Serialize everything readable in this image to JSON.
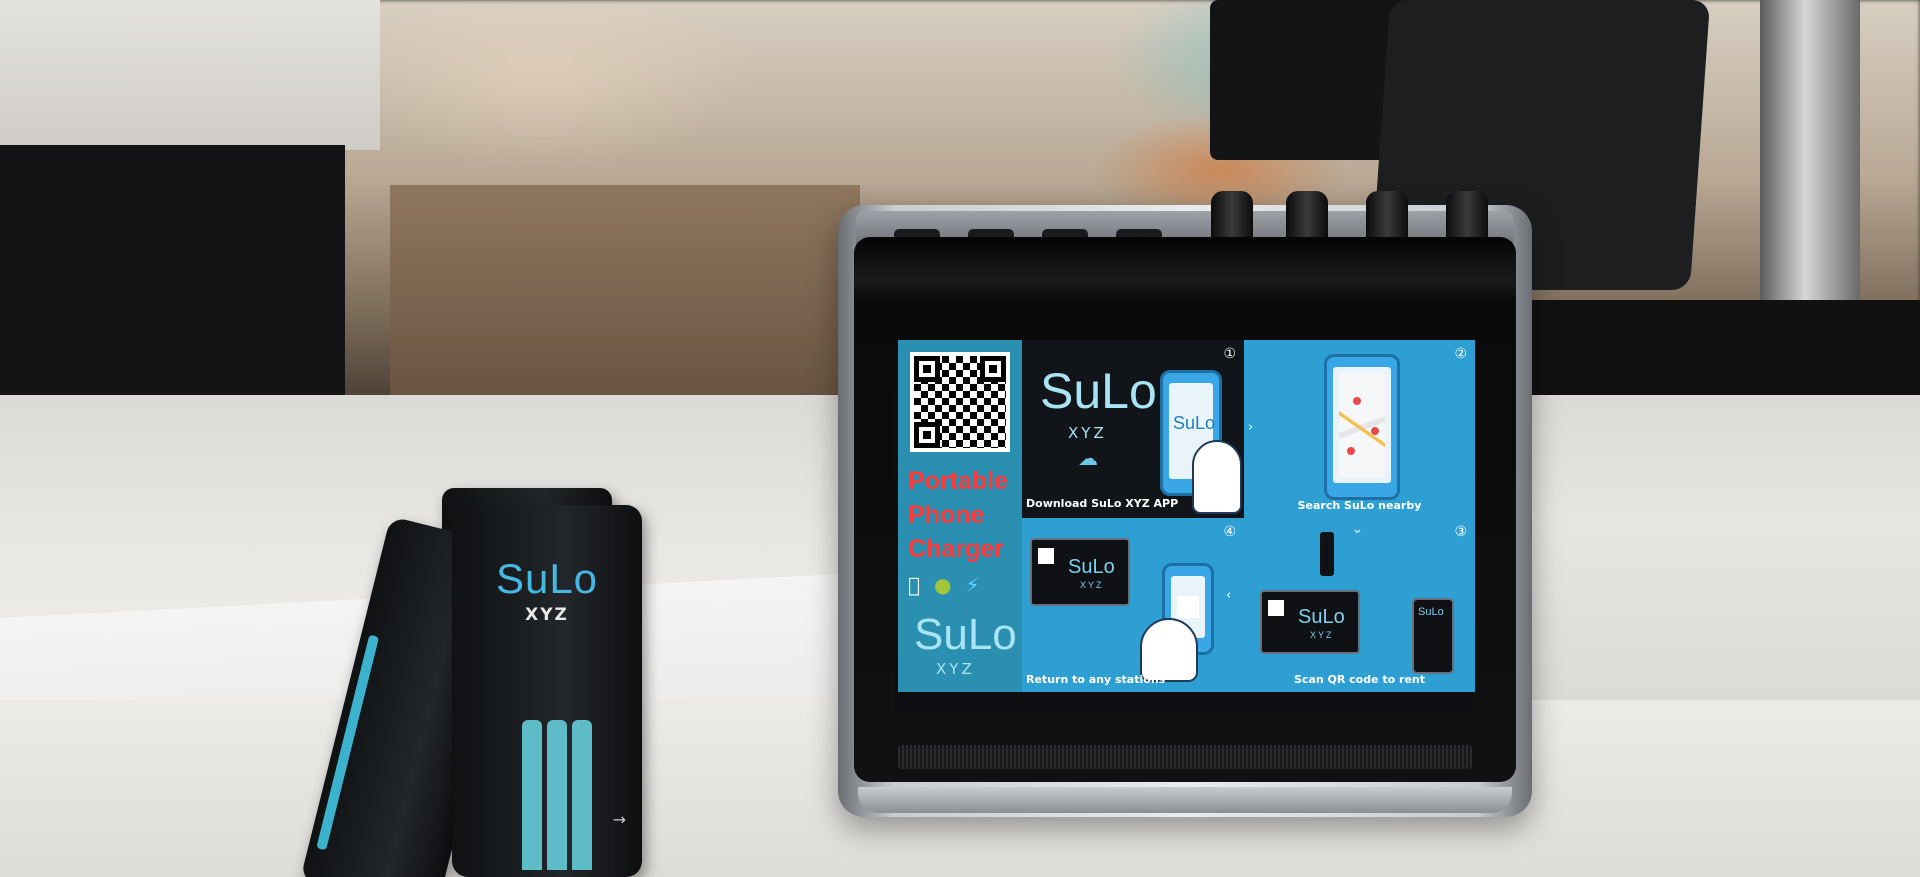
{
  "powerbank": {
    "brand": "SuLo",
    "sub": "XYZ"
  },
  "screen": {
    "promo_line1": "Portable",
    "promo_line2": "Phone",
    "promo_line3": "Charger",
    "brand": "SuLo",
    "brand_sub": "XYZ",
    "steps": [
      {
        "number": "①",
        "caption": "Download SuLo XYZ APP"
      },
      {
        "number": "②",
        "caption": "Search SuLo nearby"
      },
      {
        "number": "③",
        "caption": "Scan QR code to rent"
      },
      {
        "number": "④",
        "caption": "Return to any stations"
      }
    ]
  },
  "colors": {
    "screen_blue": "#2d9fd2",
    "promo_red": "#ff3a3a",
    "brand_cyan": "#a9e4f4",
    "cable_teal": "#5ebcc9"
  },
  "icons": [
    "apple-icon",
    "android-icon",
    "lightning-icon",
    "cloud-download-icon",
    "map-pin-icon",
    "qr-code-icon"
  ]
}
